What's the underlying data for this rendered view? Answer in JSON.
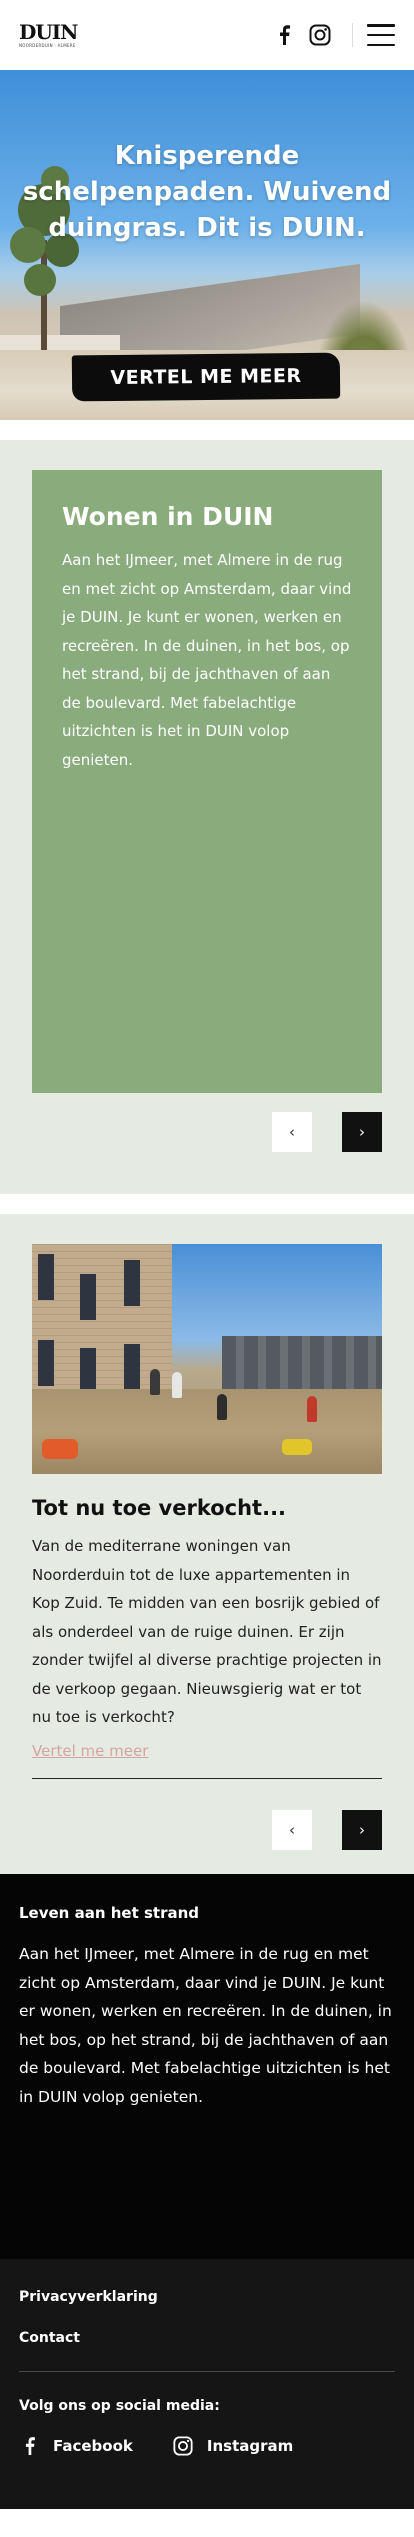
{
  "header": {
    "logo_text": "DUIN",
    "logo_sub": "NOORDERDUIN · ALMERE"
  },
  "hero": {
    "title": "Knisperende schelpenpaden. Wuivend duingras. Dit is DUIN.",
    "button_label": "VERTEL ME MEER"
  },
  "wonen": {
    "title": "Wonen in DUIN",
    "body": "Aan het IJmeer, met Almere in de rug en met zicht op Amsterdam, daar vind je DUIN. Je kunt er wonen, werken en recreëren. In de duinen, in het bos, op het strand, bij de jachthaven of aan de boulevard. Met fabelachtige uitzichten is het in DUIN volop genieten.",
    "prev_label": "‹",
    "next_label": "›"
  },
  "verkocht": {
    "title": "Tot nu toe verkocht...",
    "body": "Van de mediterrane woningen van Noorderduin tot de luxe appartementen in Kop Zuid. Te midden van een bosrijk gebied of als onderdeel van de ruige duinen. Er zijn zonder twijfel al diverse prachtige projecten in de verkoop gegaan. Nieuwsgierig wat er tot nu toe is verkocht?",
    "link_label": "Vertel me meer",
    "prev_label": "‹",
    "next_label": "›"
  },
  "info": {
    "title": "Leven aan het strand",
    "body": "Aan het IJmeer, met Almere in de rug en met zicht op Amsterdam, daar vind je DUIN. Je kunt er wonen, werken en recreëren. In de duinen, in het bos, op het strand, bij de jachthaven of aan de boulevard. Met fabelachtige uitzichten is het in DUIN volop genieten."
  },
  "footer": {
    "links": [
      "Privacyverklaring",
      "Contact"
    ],
    "follow_label": "Volg ons op social media:",
    "socials": [
      {
        "name": "Facebook",
        "icon": "facebook-icon"
      },
      {
        "name": "Instagram",
        "icon": "instagram-icon"
      }
    ]
  },
  "colors": {
    "green_card": "#8aac7c",
    "section_bg": "#e5ebe2",
    "link_pink": "#d4a5a0",
    "black": "#050505"
  }
}
